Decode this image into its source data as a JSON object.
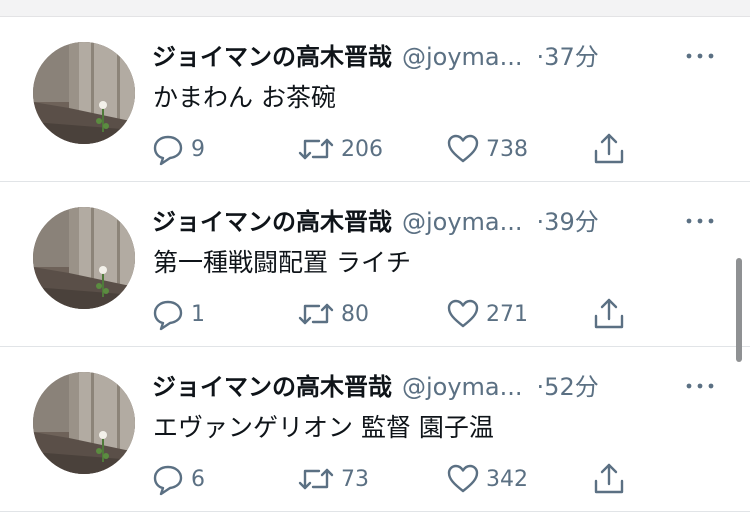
{
  "tweets": [
    {
      "display_name": "ジョイマンの高木晋哉",
      "handle": "@joyma...",
      "separator": "·",
      "time": "37分",
      "text": "かまわん  お茶碗",
      "replies": "9",
      "retweets": "206",
      "likes": "738"
    },
    {
      "display_name": "ジョイマンの高木晋哉",
      "handle": "@joyma...",
      "separator": "·",
      "time": "39分",
      "text": "第一種戦闘配置  ライチ",
      "replies": "1",
      "retweets": "80",
      "likes": "271"
    },
    {
      "display_name": "ジョイマンの高木晋哉",
      "handle": "@joyma...",
      "separator": "·",
      "time": "52分",
      "text": "エヴァンゲリオン  監督  園子温",
      "replies": "6",
      "retweets": "73",
      "likes": "342"
    }
  ],
  "colors": {
    "secondary_text": "#5b7083",
    "primary_text": "#0f1419",
    "divider": "#e1e4e7"
  },
  "icons": [
    "avatar-photo",
    "more-icon",
    "reply-icon",
    "retweet-icon",
    "like-icon",
    "share-icon"
  ]
}
